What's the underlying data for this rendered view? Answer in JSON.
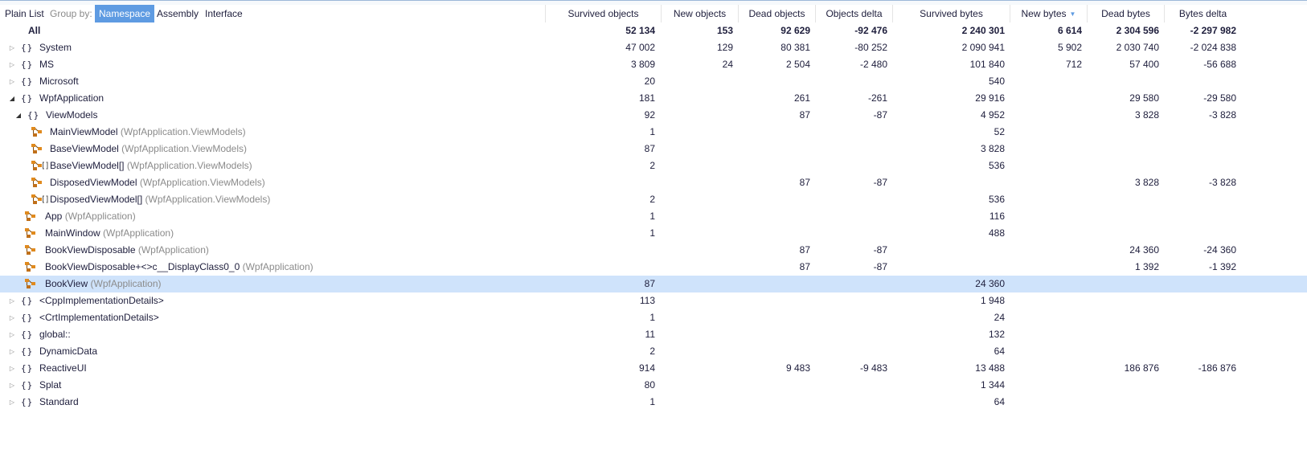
{
  "toolbar": {
    "plain_list": "Plain List",
    "group_by": "Group by:",
    "namespace": "Namespace",
    "assembly": "Assembly",
    "interface": "Interface"
  },
  "columns": {
    "survived_objects": "Survived objects",
    "new_objects": "New objects",
    "dead_objects": "Dead objects",
    "objects_delta": "Objects delta",
    "survived_bytes": "Survived bytes",
    "new_bytes": "New bytes",
    "dead_bytes": "Dead bytes",
    "bytes_delta": "Bytes delta"
  },
  "sort": {
    "column": "new_bytes",
    "direction": "descending"
  },
  "rows": [
    {
      "kind": "all",
      "name": "All",
      "ctx": "",
      "level": 0,
      "expander": "none",
      "survived_objects": "52 134",
      "new_objects": "153",
      "dead_objects": "92 629",
      "objects_delta": "-92 476",
      "survived_bytes": "2 240 301",
      "new_bytes": "6 614",
      "dead_bytes": "2 304 596",
      "bytes_delta": "-2 297 982"
    },
    {
      "kind": "ns",
      "name": "System",
      "ctx": "",
      "level": 0,
      "expander": "collapsed",
      "survived_objects": "47 002",
      "new_objects": "129",
      "dead_objects": "80 381",
      "objects_delta": "-80 252",
      "survived_bytes": "2 090 941",
      "new_bytes": "5 902",
      "dead_bytes": "2 030 740",
      "bytes_delta": "-2 024 838"
    },
    {
      "kind": "ns",
      "name": "MS",
      "ctx": "",
      "level": 0,
      "expander": "collapsed",
      "survived_objects": "3 809",
      "new_objects": "24",
      "dead_objects": "2 504",
      "objects_delta": "-2 480",
      "survived_bytes": "101 840",
      "new_bytes": "712",
      "dead_bytes": "57 400",
      "bytes_delta": "-56 688"
    },
    {
      "kind": "ns",
      "name": "Microsoft",
      "ctx": "",
      "level": 0,
      "expander": "collapsed",
      "survived_objects": "20",
      "new_objects": "",
      "dead_objects": "",
      "objects_delta": "",
      "survived_bytes": "540",
      "new_bytes": "",
      "dead_bytes": "",
      "bytes_delta": ""
    },
    {
      "kind": "ns",
      "name": "WpfApplication",
      "ctx": "",
      "level": 0,
      "expander": "expanded",
      "survived_objects": "181",
      "new_objects": "",
      "dead_objects": "261",
      "objects_delta": "-261",
      "survived_bytes": "29 916",
      "new_bytes": "",
      "dead_bytes": "29 580",
      "bytes_delta": "-29 580"
    },
    {
      "kind": "ns",
      "name": "ViewModels",
      "ctx": "",
      "level": 1,
      "expander": "expanded",
      "survived_objects": "92",
      "new_objects": "",
      "dead_objects": "87",
      "objects_delta": "-87",
      "survived_bytes": "4 952",
      "new_bytes": "",
      "dead_bytes": "3 828",
      "bytes_delta": "-3 828"
    },
    {
      "kind": "class",
      "name": "MainViewModel",
      "ctx": "(WpfApplication.ViewModels)",
      "level": 2,
      "expander": "none",
      "survived_objects": "1",
      "new_objects": "",
      "dead_objects": "",
      "objects_delta": "",
      "survived_bytes": "52",
      "new_bytes": "",
      "dead_bytes": "",
      "bytes_delta": ""
    },
    {
      "kind": "class",
      "name": "BaseViewModel",
      "ctx": "(WpfApplication.ViewModels)",
      "level": 2,
      "expander": "none",
      "survived_objects": "87",
      "new_objects": "",
      "dead_objects": "",
      "objects_delta": "",
      "survived_bytes": "3 828",
      "new_bytes": "",
      "dead_bytes": "",
      "bytes_delta": ""
    },
    {
      "kind": "array",
      "name": "BaseViewModel[]",
      "ctx": "(WpfApplication.ViewModels)",
      "level": 2,
      "expander": "none",
      "survived_objects": "2",
      "new_objects": "",
      "dead_objects": "",
      "objects_delta": "",
      "survived_bytes": "536",
      "new_bytes": "",
      "dead_bytes": "",
      "bytes_delta": ""
    },
    {
      "kind": "class",
      "name": "DisposedViewModel",
      "ctx": "(WpfApplication.ViewModels)",
      "level": 2,
      "expander": "none",
      "survived_objects": "",
      "new_objects": "",
      "dead_objects": "87",
      "objects_delta": "-87",
      "survived_bytes": "",
      "new_bytes": "",
      "dead_bytes": "3 828",
      "bytes_delta": "-3 828"
    },
    {
      "kind": "array",
      "name": "DisposedViewModel[]",
      "ctx": "(WpfApplication.ViewModels)",
      "level": 2,
      "expander": "none",
      "survived_objects": "2",
      "new_objects": "",
      "dead_objects": "",
      "objects_delta": "",
      "survived_bytes": "536",
      "new_bytes": "",
      "dead_bytes": "",
      "bytes_delta": ""
    },
    {
      "kind": "class",
      "name": "App",
      "ctx": "(WpfApplication)",
      "level": 1,
      "expander": "none",
      "survived_objects": "1",
      "new_objects": "",
      "dead_objects": "",
      "objects_delta": "",
      "survived_bytes": "116",
      "new_bytes": "",
      "dead_bytes": "",
      "bytes_delta": ""
    },
    {
      "kind": "class",
      "name": "MainWindow",
      "ctx": "(WpfApplication)",
      "level": 1,
      "expander": "none",
      "survived_objects": "1",
      "new_objects": "",
      "dead_objects": "",
      "objects_delta": "",
      "survived_bytes": "488",
      "new_bytes": "",
      "dead_bytes": "",
      "bytes_delta": ""
    },
    {
      "kind": "class",
      "name": "BookViewDisposable",
      "ctx": "(WpfApplication)",
      "level": 1,
      "expander": "none",
      "survived_objects": "",
      "new_objects": "",
      "dead_objects": "87",
      "objects_delta": "-87",
      "survived_bytes": "",
      "new_bytes": "",
      "dead_bytes": "24 360",
      "bytes_delta": "-24 360"
    },
    {
      "kind": "class",
      "name": "BookViewDisposable+<>c__DisplayClass0_0",
      "ctx": "(WpfApplication)",
      "level": 1,
      "expander": "none",
      "survived_objects": "",
      "new_objects": "",
      "dead_objects": "87",
      "objects_delta": "-87",
      "survived_bytes": "",
      "new_bytes": "",
      "dead_bytes": "1 392",
      "bytes_delta": "-1 392"
    },
    {
      "kind": "class",
      "name": "BookView",
      "ctx": "(WpfApplication)",
      "level": 1,
      "expander": "none",
      "selected": true,
      "survived_objects": "87",
      "new_objects": "",
      "dead_objects": "",
      "objects_delta": "",
      "survived_bytes": "24 360",
      "new_bytes": "",
      "dead_bytes": "",
      "bytes_delta": ""
    },
    {
      "kind": "ns",
      "name": "<CppImplementationDetails>",
      "ctx": "",
      "level": 0,
      "expander": "collapsed",
      "survived_objects": "113",
      "new_objects": "",
      "dead_objects": "",
      "objects_delta": "",
      "survived_bytes": "1 948",
      "new_bytes": "",
      "dead_bytes": "",
      "bytes_delta": ""
    },
    {
      "kind": "ns",
      "name": "<CrtImplementationDetails>",
      "ctx": "",
      "level": 0,
      "expander": "collapsed",
      "survived_objects": "1",
      "new_objects": "",
      "dead_objects": "",
      "objects_delta": "",
      "survived_bytes": "24",
      "new_bytes": "",
      "dead_bytes": "",
      "bytes_delta": ""
    },
    {
      "kind": "ns",
      "name": "global::",
      "ctx": "",
      "level": 0,
      "expander": "collapsed",
      "survived_objects": "11",
      "new_objects": "",
      "dead_objects": "",
      "objects_delta": "",
      "survived_bytes": "132",
      "new_bytes": "",
      "dead_bytes": "",
      "bytes_delta": ""
    },
    {
      "kind": "ns",
      "name": "DynamicData",
      "ctx": "",
      "level": 0,
      "expander": "collapsed",
      "survived_objects": "2",
      "new_objects": "",
      "dead_objects": "",
      "objects_delta": "",
      "survived_bytes": "64",
      "new_bytes": "",
      "dead_bytes": "",
      "bytes_delta": ""
    },
    {
      "kind": "ns",
      "name": "ReactiveUI",
      "ctx": "",
      "level": 0,
      "expander": "collapsed",
      "survived_objects": "914",
      "new_objects": "",
      "dead_objects": "9 483",
      "objects_delta": "-9 483",
      "survived_bytes": "13 488",
      "new_bytes": "",
      "dead_bytes": "186 876",
      "bytes_delta": "-186 876"
    },
    {
      "kind": "ns",
      "name": "Splat",
      "ctx": "",
      "level": 0,
      "expander": "collapsed",
      "survived_objects": "80",
      "new_objects": "",
      "dead_objects": "",
      "objects_delta": "",
      "survived_bytes": "1 344",
      "new_bytes": "",
      "dead_bytes": "",
      "bytes_delta": ""
    },
    {
      "kind": "ns",
      "name": "Standard",
      "ctx": "",
      "level": 0,
      "expander": "collapsed",
      "survived_objects": "1",
      "new_objects": "",
      "dead_objects": "",
      "objects_delta": "",
      "survived_bytes": "64",
      "new_bytes": "",
      "dead_bytes": "",
      "bytes_delta": ""
    }
  ]
}
